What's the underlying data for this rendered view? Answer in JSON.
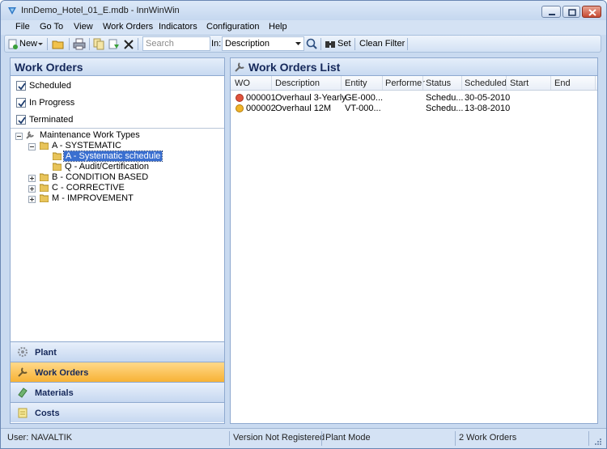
{
  "window": {
    "title": "InnDemo_Hotel_01_E.mdb - InnWinWin"
  },
  "menu": [
    "File",
    "Go To",
    "View",
    "Work Orders",
    "Indicators",
    "Configuration",
    "Help"
  ],
  "toolbar": {
    "new_label": "New",
    "search_placeholder": "Search",
    "in_label": "In:",
    "in_value": "Description",
    "set_label": "Set",
    "clean_filter_label": "Clean Filter"
  },
  "left_panel": {
    "title": "Work Orders",
    "filters": [
      {
        "label": "Scheduled",
        "checked": true
      },
      {
        "label": "In Progress",
        "checked": true
      },
      {
        "label": "Terminated",
        "checked": true
      }
    ],
    "tree": {
      "root": "Maintenance Work Types",
      "nodes": [
        {
          "label": "A - SYSTEMATIC",
          "expanded": true
        },
        {
          "label": "A - Systematic schedule",
          "selected": true
        },
        {
          "label": "Q - Audit/Certification"
        },
        {
          "label": "B - CONDITION BASED"
        },
        {
          "label": "C - CORRECTIVE"
        },
        {
          "label": "M - IMPROVEMENT"
        }
      ]
    }
  },
  "nav": [
    {
      "label": "Plant",
      "icon": "gear-icon",
      "active": false
    },
    {
      "label": "Work Orders",
      "icon": "wrench-icon",
      "active": true
    },
    {
      "label": "Materials",
      "icon": "materials-icon",
      "active": false
    },
    {
      "label": "Costs",
      "icon": "costs-icon",
      "active": false
    }
  ],
  "list": {
    "title": "Work Orders List",
    "columns": [
      "WO",
      "Description",
      "Entity",
      "Performer",
      "Status",
      "Scheduled",
      "Start",
      "End"
    ],
    "rows": [
      {
        "wo": "000001",
        "description": "Overhaul 3-Yearly",
        "entity": "GE-000...",
        "performer": "",
        "status": "Schedu...",
        "scheduled": "30-05-2010",
        "start": "",
        "end": "",
        "status_color": "#e0533c"
      },
      {
        "wo": "000002",
        "description": "Overhaul 12M",
        "entity": "VT-000...",
        "performer": "",
        "status": "Schedu...",
        "scheduled": "13-08-2010",
        "start": "",
        "end": "",
        "status_color": "#f0b429"
      }
    ]
  },
  "status": {
    "user": "User: NAVALTIK",
    "version": "Version Not Registered",
    "mode": "Plant Mode",
    "count": "2 Work Orders"
  }
}
